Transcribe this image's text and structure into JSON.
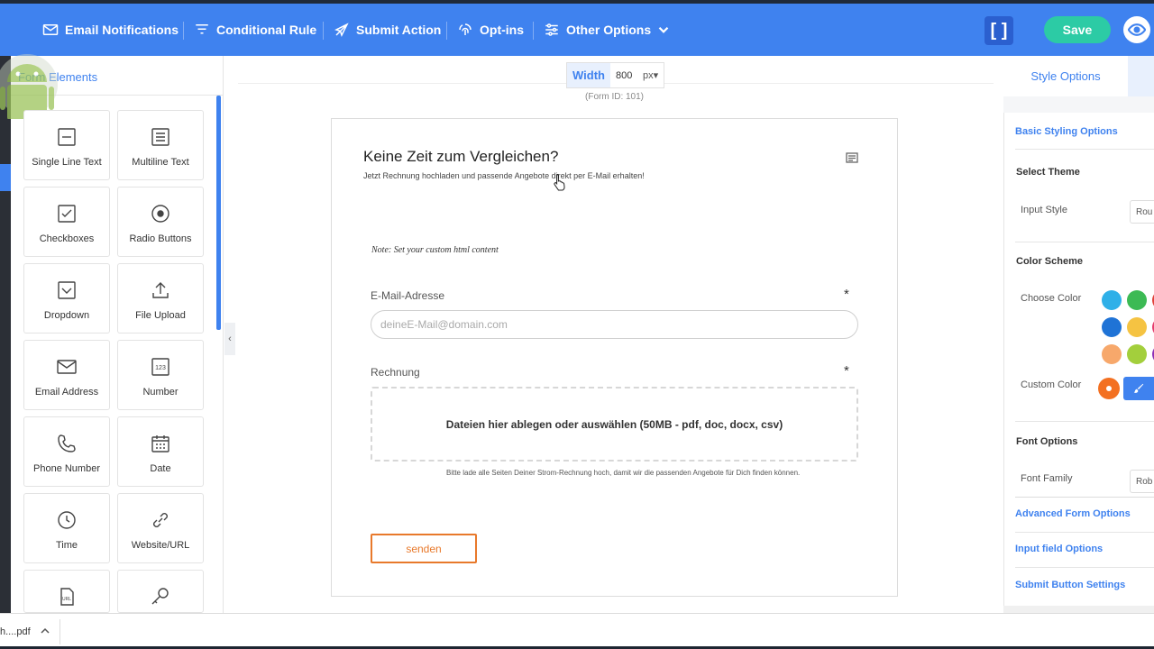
{
  "colors": {
    "primary": "#3f82ef",
    "save": "#2ccba5",
    "submit_border": "#e8792b",
    "custom_color": "#f37021"
  },
  "toolbar": {
    "email_notifications": "Email Notifications",
    "conditional_rule": "Conditional Rule",
    "submit_action": "Submit Action",
    "optins": "Opt-ins",
    "other_options": "Other Options",
    "bracket": "[ ]",
    "save": "Save"
  },
  "left_panel": {
    "title": "Form Elements",
    "tiles": [
      {
        "label": "Single Line Text",
        "icon": "single-line-text-icon"
      },
      {
        "label": "Multiline Text",
        "icon": "multiline-text-icon"
      },
      {
        "label": "Checkboxes",
        "icon": "checkbox-icon"
      },
      {
        "label": "Radio Buttons",
        "icon": "radio-icon"
      },
      {
        "label": "Dropdown",
        "icon": "dropdown-icon"
      },
      {
        "label": "File Upload",
        "icon": "upload-icon"
      },
      {
        "label": "Email Address",
        "icon": "envelope-icon"
      },
      {
        "label": "Number",
        "icon": "number-icon"
      },
      {
        "label": "Phone Number",
        "icon": "phone-icon"
      },
      {
        "label": "Date",
        "icon": "calendar-icon"
      },
      {
        "label": "Time",
        "icon": "clock-icon"
      },
      {
        "label": "Website/URL",
        "icon": "link-icon"
      },
      {
        "label": "",
        "icon": "url-file-icon"
      },
      {
        "label": "",
        "icon": "key-icon"
      }
    ]
  },
  "canvas": {
    "width_label": "Width",
    "width_value": "800",
    "width_unit": "px",
    "form_id": "(Form ID: 101)",
    "form_title": "Keine Zeit zum Vergleichen?",
    "form_subtitle": "Jetzt Rechnung hochladen und passende Angebote direkt per E-Mail erhalten!",
    "note": "Note: Set your custom html content",
    "email_label": "E-Mail-Adresse",
    "email_placeholder": "deineE-Mail@domain.com",
    "required_mark": "*",
    "upload_label": "Rechnung",
    "upload_text": "Dateien hier ablegen oder auswählen (50MB - pdf, doc, docx, csv)",
    "upload_hint": "Bitte lade alle Seiten Deiner Strom-Rechnung hoch, damit wir die passenden Angebote für Dich finden können.",
    "submit_label": "senden"
  },
  "right_panel": {
    "tab_style": "Style Options",
    "basic_styling": "Basic Styling Options",
    "select_theme": "Select Theme",
    "input_style": "Input Style",
    "input_style_value": "Rou",
    "color_scheme": "Color Scheme",
    "choose_color": "Choose Color",
    "swatches": [
      "#2fb0e8",
      "#3cba54",
      "#e0413a",
      "#1f73d6",
      "#f5c342",
      "#e53d6e",
      "#f7a86b",
      "#a3cf3c",
      "#8e2fb6"
    ],
    "custom_color": "Custom Color",
    "font_options": "Font Options",
    "font_family": "Font Family",
    "font_family_value": "Rob",
    "advanced_form": "Advanced Form Options",
    "input_field": "Input field Options",
    "submit_settings": "Submit Button Settings"
  },
  "download_bar": {
    "file": "h....pdf"
  }
}
